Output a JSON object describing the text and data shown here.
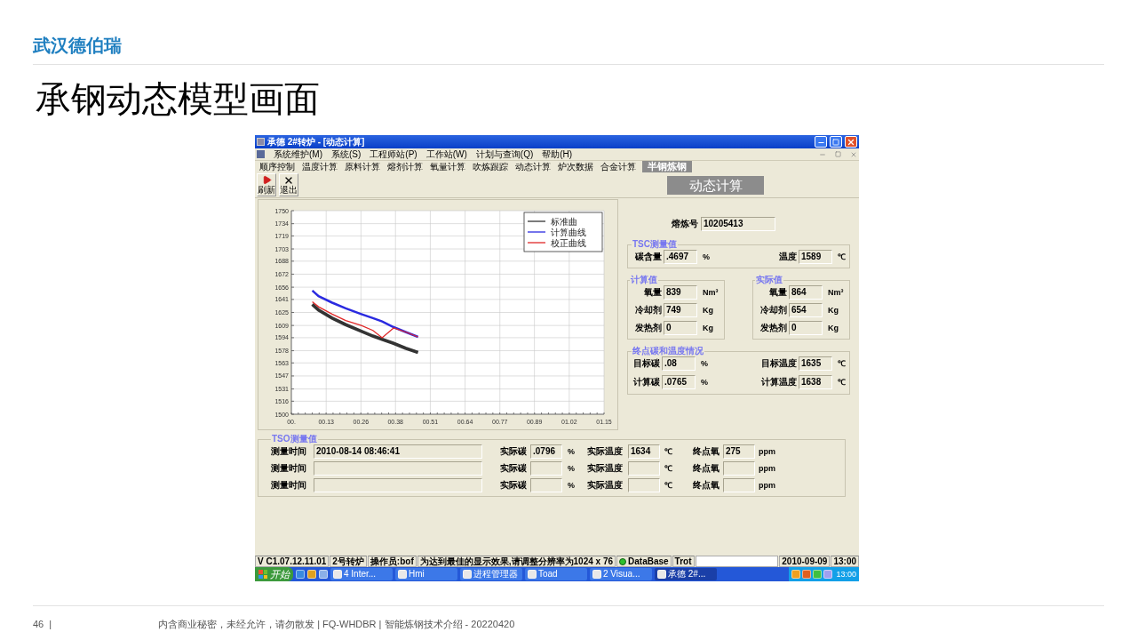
{
  "slide": {
    "brand": "武汉德伯瑞",
    "title": "承钢动态模型画面",
    "page": "46",
    "separator": "|",
    "footer": "内含商业秘密，未经允许，请勿散发 | FQ-WHDBR | 智能炼钢技术介绍 - 20220420"
  },
  "app": {
    "title": "承德 2#转炉 - [动态计算]",
    "menu": [
      "系统维护(M)",
      "系统(S)",
      "工程师站(P)",
      "工作站(W)",
      "计划与查询(Q)",
      "帮助(H)"
    ],
    "tabs": [
      {
        "label": "顺序控制",
        "selected": false
      },
      {
        "label": "温度计算",
        "selected": false
      },
      {
        "label": "原料计算",
        "selected": false
      },
      {
        "label": "熔剂计算",
        "selected": false
      },
      {
        "label": "氧量计算",
        "selected": false
      },
      {
        "label": "吹炼跟踪",
        "selected": false
      },
      {
        "label": "动态计算",
        "selected": false
      },
      {
        "label": "炉次数据",
        "selected": false
      },
      {
        "label": "合金计算",
        "selected": false
      },
      {
        "label": "半钢炼钢",
        "selected": true
      }
    ],
    "toolbar": [
      {
        "label": "刷新",
        "kind": "refresh"
      },
      {
        "label": "退出",
        "kind": "exit"
      }
    ],
    "panel_title": "动态计算",
    "chart_data": {
      "type": "line",
      "x": [
        0.077,
        0.1,
        0.15,
        0.2,
        0.257,
        0.3,
        0.334,
        0.376,
        0.42,
        0.466
      ],
      "series": [
        {
          "name": "标准曲",
          "color": "#333333",
          "values": [
            1635,
            1628,
            1618,
            1610,
            1602,
            1596,
            1592,
            1587,
            1581,
            1576
          ]
        },
        {
          "name": "计算曲线",
          "color": "#2a2ae0",
          "values": [
            1652,
            1645,
            1637,
            1630,
            1623,
            1618,
            1614,
            1607,
            1601,
            1595
          ]
        },
        {
          "name": "校正曲线",
          "color": "#e02828",
          "values": [
            1638,
            1632,
            1623,
            1615,
            1609,
            1603,
            1594,
            1606,
            1601,
            1595
          ]
        }
      ],
      "xlim": [
        0,
        1.15
      ],
      "ylim": [
        1500,
        1750
      ],
      "xticks": [
        {
          "value": 0,
          "label": "00."
        },
        {
          "value": 0.128,
          "label": "00.13"
        },
        {
          "value": 0.256,
          "label": "00.26"
        },
        {
          "value": 0.383,
          "label": "00.38"
        },
        {
          "value": 0.511,
          "label": "00.51"
        },
        {
          "value": 0.639,
          "label": "00.64"
        },
        {
          "value": 0.767,
          "label": "00.77"
        },
        {
          "value": 0.894,
          "label": "00.89"
        },
        {
          "value": 1.022,
          "label": "01.02"
        },
        {
          "value": 1.15,
          "label": "01.15"
        }
      ],
      "yticks": [
        1500,
        1516,
        1531,
        1547,
        1563,
        1578,
        1594,
        1609,
        1625,
        1641,
        1656,
        1672,
        1688,
        1703,
        1719,
        1734,
        1750
      ],
      "grid": true,
      "legend": true
    },
    "heat_no": {
      "label": "熔炼号",
      "value": "10205413"
    },
    "tsc": {
      "title": "TSC测量值",
      "fields": [
        {
          "label": "碳含量",
          "value": ".4697",
          "unit": "%"
        },
        {
          "label": "温度",
          "value": "1589",
          "unit": "℃"
        }
      ]
    },
    "calc": {
      "title": "计算值",
      "fields": [
        {
          "label": "氧量",
          "value": "839",
          "unit": "Nm³"
        },
        {
          "label": "冷却剂",
          "value": "749",
          "unit": "Kg"
        },
        {
          "label": "发热剂",
          "value": "0",
          "unit": "Kg"
        }
      ]
    },
    "actual": {
      "title": "实际值",
      "fields": [
        {
          "label": "氧量",
          "value": "864",
          "unit": "Nm³"
        },
        {
          "label": "冷却剂",
          "value": "654",
          "unit": "Kg"
        },
        {
          "label": "发热剂",
          "value": "0",
          "unit": "Kg"
        }
      ]
    },
    "endpoint": {
      "title": "终点碳和温度情况",
      "fields": [
        {
          "label": "目标碳",
          "value": ".08",
          "unit": "%"
        },
        {
          "label": "目标温度",
          "value": "1635",
          "unit": "℃"
        },
        {
          "label": "计算碳",
          "value": ".0765",
          "unit": "%"
        },
        {
          "label": "计算温度",
          "value": "1638",
          "unit": "℃"
        }
      ]
    },
    "tso": {
      "title": "TSO测量值",
      "rows": [
        {
          "time_label": "测量时间",
          "time": "2010-08-14 08:46:41",
          "carbon_label": "实际碳",
          "carbon": ".0796",
          "carbon_unit": "%",
          "temp_label": "实际温度",
          "temp": "1634",
          "temp_unit": "℃",
          "oxygen_label": "终点氧",
          "oxygen": "275",
          "oxygen_unit": "ppm"
        },
        {
          "time_label": "测量时间",
          "carbon_label": "实际碳",
          "carbon_unit": "%",
          "temp_label": "实际温度",
          "temp_unit": "℃",
          "oxygen_label": "终点氧",
          "oxygen_unit": "ppm"
        },
        {
          "time_label": "测量时间",
          "carbon_label": "实际碳",
          "carbon_unit": "%",
          "temp_label": "实际温度",
          "temp_unit": "℃",
          "oxygen_label": "终点氧",
          "oxygen_unit": "ppm"
        }
      ]
    },
    "status_bar": [
      {
        "kind": "text",
        "text": "V C1.07.12.11.01"
      },
      {
        "kind": "text",
        "text": "2号转炉"
      },
      {
        "kind": "text",
        "text": "操作员:bof"
      },
      {
        "kind": "text",
        "text": "为达到最佳的显示效果,请调整分辨率为1024 x 76"
      },
      {
        "kind": "database",
        "text": "DataBase"
      },
      {
        "kind": "text",
        "text": "Trot"
      },
      {
        "kind": "spacer"
      },
      {
        "kind": "text",
        "text": "2010-09-09"
      },
      {
        "kind": "text",
        "text": "13:00"
      }
    ],
    "taskbar": {
      "start": "开始",
      "tasks": [
        "4 Inter...",
        "Hmi",
        "进程管理器",
        "Toad",
        "2 Visua...",
        "承德 2#..."
      ],
      "clock": "13:00"
    }
  }
}
